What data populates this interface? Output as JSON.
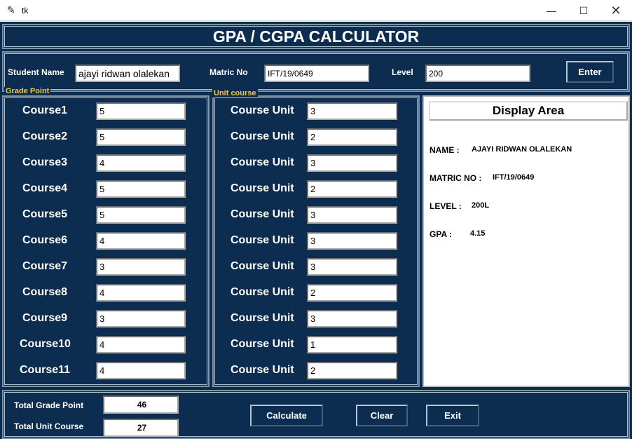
{
  "window": {
    "title": "tk",
    "minimize_icon": "minimize-icon",
    "maximize_icon": "maximize-icon",
    "close_icon": "close-icon"
  },
  "header": {
    "title": "GPA / CGPA CALCULATOR"
  },
  "student": {
    "name_label": "Student Name",
    "name_value": "ajayi ridwan olalekan",
    "matric_label": "Matric No",
    "matric_value": "IFT/19/0649",
    "level_label": "Level",
    "level_value": "200",
    "enter_button": "Enter"
  },
  "grade_frame": {
    "title": "Grade Point"
  },
  "unit_frame": {
    "title": "Unit course"
  },
  "courses": [
    {
      "name": "Course1",
      "grade": "5",
      "unit_label": "Course Unit",
      "unit": "3"
    },
    {
      "name": "Course2",
      "grade": "5",
      "unit_label": "Course Unit",
      "unit": "2"
    },
    {
      "name": "Course3",
      "grade": "4",
      "unit_label": "Course Unit",
      "unit": "3"
    },
    {
      "name": "Course4",
      "grade": "5",
      "unit_label": "Course Unit",
      "unit": "2"
    },
    {
      "name": "Course5",
      "grade": "5",
      "unit_label": "Course Unit",
      "unit": "3"
    },
    {
      "name": "Course6",
      "grade": "4",
      "unit_label": "Course Unit",
      "unit": "3"
    },
    {
      "name": "Course7",
      "grade": "3",
      "unit_label": "Course Unit",
      "unit": "3"
    },
    {
      "name": "Course8",
      "grade": "4",
      "unit_label": "Course Unit",
      "unit": "2"
    },
    {
      "name": "Course9",
      "grade": "3",
      "unit_label": "Course Unit",
      "unit": "3"
    },
    {
      "name": "Course10",
      "grade": "4",
      "unit_label": "Course Unit",
      "unit": "1"
    },
    {
      "name": "Course11",
      "grade": "4",
      "unit_label": "Course Unit",
      "unit": "2"
    }
  ],
  "display": {
    "title": "Display Area",
    "name_key": "NAME :",
    "name_val": "AJAYI RIDWAN OLALEKAN",
    "matric_key": "MATRIC NO :",
    "matric_val": "IFT/19/0649",
    "level_key": "LEVEL :",
    "level_val": "200L",
    "gpa_key": "GPA :",
    "gpa_val": "4.15"
  },
  "totals": {
    "grade_label": "Total Grade Point",
    "grade_value": "46",
    "unit_label": "Total Unit Course",
    "unit_value": "27"
  },
  "actions": {
    "calculate": "Calculate",
    "clear": "Clear",
    "exit": "Exit"
  },
  "colors": {
    "background": "#0c2d50",
    "frame_title": "#f3c744",
    "text": "#ffffff"
  }
}
